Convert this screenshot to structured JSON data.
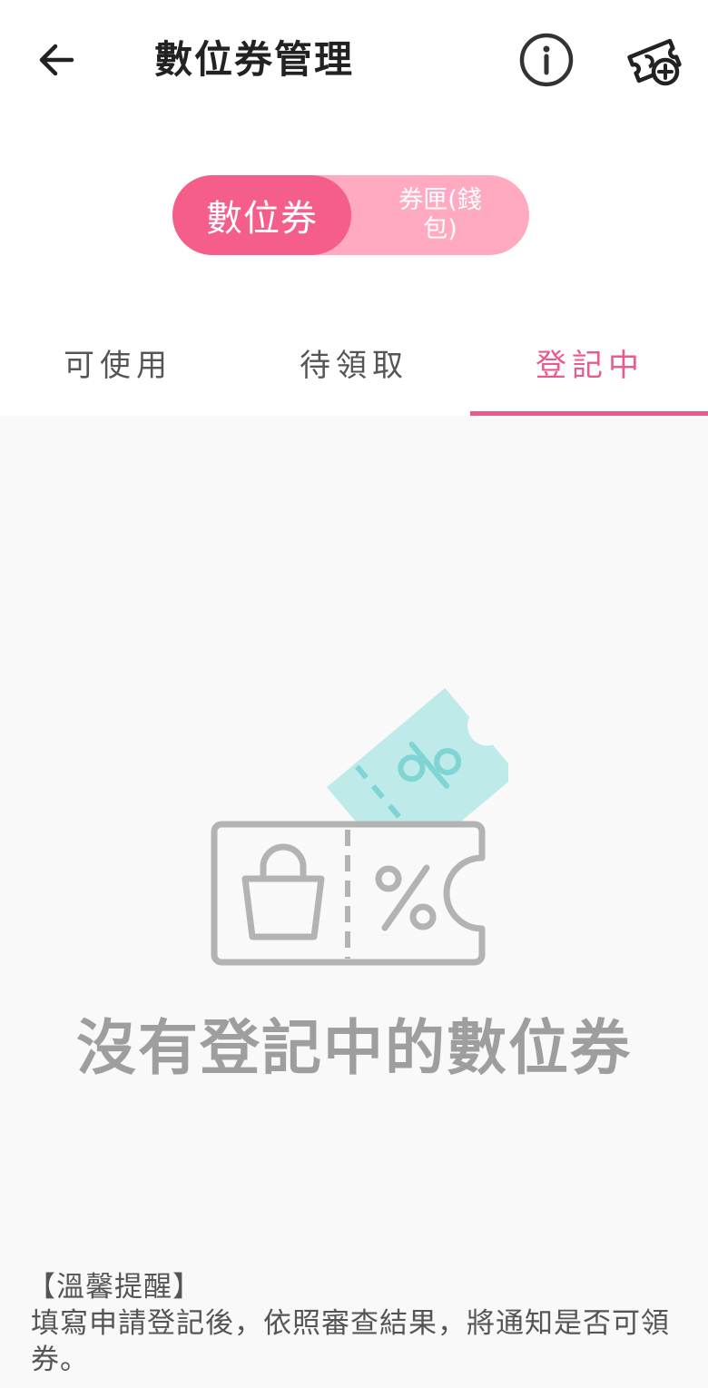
{
  "header": {
    "title": "數位券管理",
    "back_icon": "arrow-left-icon",
    "info_icon": "info-circle-icon",
    "add_icon": "ticket-add-icon"
  },
  "segment": {
    "active_label": "數位券",
    "inactive_label": "券匣(錢包)",
    "active_color": "#f55e8a",
    "inactive_color": "#ffaac1"
  },
  "tabs": [
    {
      "label": "可使用",
      "selected": false
    },
    {
      "label": "待領取",
      "selected": false
    },
    {
      "label": "登記中",
      "selected": true
    }
  ],
  "accent_color": "#ea5b8a",
  "empty_state": {
    "icon": "coupon-empty-icon",
    "message": "沒有登記中的數位券"
  },
  "notice": {
    "title": "【溫馨提醒】",
    "body": "填寫申請登記後，依照審查結果，將通知是否可領券。"
  }
}
